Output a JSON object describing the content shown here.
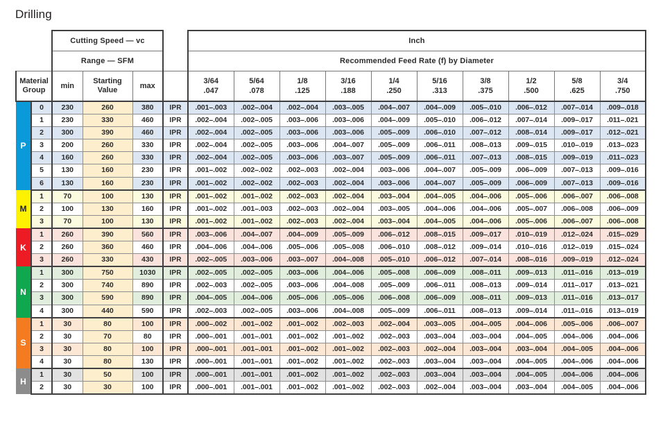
{
  "page": {
    "title": "Drilling"
  },
  "header": {
    "cutting_speed": "Cutting Speed — vc",
    "range_sfm": "Range — SFM",
    "unit_system": "Inch",
    "feed_rate": "Recommended Feed Rate (f) by Diameter",
    "material_group_l1": "Material",
    "material_group_l2": "Group",
    "min": "min",
    "starting_value_l1": "Starting",
    "starting_value_l2": "Value",
    "max": "max",
    "diameters": [
      {
        "fraction": "3/64",
        "decimal": ".047"
      },
      {
        "fraction": "5/64",
        "decimal": ".078"
      },
      {
        "fraction": "1/8",
        "decimal": ".125"
      },
      {
        "fraction": "3/16",
        "decimal": ".188"
      },
      {
        "fraction": "1/4",
        "decimal": ".250"
      },
      {
        "fraction": "5/16",
        "decimal": ".313"
      },
      {
        "fraction": "3/8",
        "decimal": ".375"
      },
      {
        "fraction": "1/2",
        "decimal": ".500"
      },
      {
        "fraction": "5/8",
        "decimal": ".625"
      },
      {
        "fraction": "3/4",
        "decimal": ".750"
      }
    ]
  },
  "colors": {
    "group_P": "#0b9ad9",
    "group_M": "#fff200",
    "group_K": "#ed1c24",
    "group_N": "#0fa84e",
    "group_S": "#f47b20",
    "group_H": "#8c8c8c",
    "tint_P": "#dce6f2",
    "tint_M": "#fbfbe0",
    "tint_K": "#fae3dc",
    "tint_N": "#e2eedd",
    "tint_S": "#fce7d4",
    "tint_H": "#e2e2e2",
    "starting_value_fill": "#fdeecd",
    "row_alt_fill": "#ffffff",
    "grid_line": "#8d8e90",
    "border_heavy": "#3f3f41"
  },
  "groups": [
    {
      "code": "P",
      "color": "#0b9ad9",
      "tint": "#dce6f2",
      "label_color": "#ffffff",
      "rows": [
        {
          "group_no": "0",
          "min": "230",
          "start": "260",
          "max": "380",
          "unit": "IPR",
          "feeds": [
            ".001–.003",
            ".002–.004",
            ".002–.004",
            ".003–.005",
            ".004–.007",
            ".004–.009",
            ".005–.010",
            ".006–.012",
            ".007–.014",
            ".009–.018"
          ]
        },
        {
          "group_no": "1",
          "min": "230",
          "start": "330",
          "max": "460",
          "unit": "IPR",
          "feeds": [
            ".002–.004",
            ".002–.005",
            ".003–.006",
            ".003–.006",
            ".004–.009",
            ".005–.010",
            ".006–.012",
            ".007–.014",
            ".009–.017",
            ".011–.021"
          ]
        },
        {
          "group_no": "2",
          "min": "300",
          "start": "390",
          "max": "460",
          "unit": "IPR",
          "feeds": [
            ".002–.004",
            ".002–.005",
            ".003–.006",
            ".003–.006",
            ".005–.009",
            ".006–.010",
            ".007–.012",
            ".008–.014",
            ".009–.017",
            ".012–.021"
          ]
        },
        {
          "group_no": "3",
          "min": "200",
          "start": "260",
          "max": "330",
          "unit": "IPR",
          "feeds": [
            ".002–.004",
            ".002–.005",
            ".003–.006",
            ".004–.007",
            ".005–.009",
            ".006–.011",
            ".008–.013",
            ".009–.015",
            ".010–.019",
            ".013–.023"
          ]
        },
        {
          "group_no": "4",
          "min": "160",
          "start": "260",
          "max": "330",
          "unit": "IPR",
          "feeds": [
            ".002–.004",
            ".002–.005",
            ".003–.006",
            ".003–.007",
            ".005–.009",
            ".006–.011",
            ".007–.013",
            ".008–.015",
            ".009–.019",
            ".011–.023"
          ]
        },
        {
          "group_no": "5",
          "min": "130",
          "start": "160",
          "max": "230",
          "unit": "IPR",
          "feeds": [
            ".001–.002",
            ".002–.002",
            ".002–.003",
            ".002–.004",
            ".003–.006",
            ".004–.007",
            ".005–.009",
            ".006–.009",
            ".007–.013",
            ".009–.016"
          ]
        },
        {
          "group_no": "6",
          "min": "130",
          "start": "160",
          "max": "230",
          "unit": "IPR",
          "feeds": [
            ".001–.002",
            ".002–.002",
            ".002–.003",
            ".002–.004",
            ".003–.006",
            ".004–.007",
            ".005–.009",
            ".006–.009",
            ".007–.013",
            ".009–.016"
          ]
        }
      ]
    },
    {
      "code": "M",
      "color": "#fff200",
      "tint": "#fbfbe0",
      "label_color": "#231f20",
      "rows": [
        {
          "group_no": "1",
          "min": "70",
          "start": "100",
          "max": "130",
          "unit": "IPR",
          "feeds": [
            ".001–.002",
            ".001–.002",
            ".002–.003",
            ".002–.004",
            ".003–.004",
            ".004–.005",
            ".004–.006",
            ".005–.006",
            ".006–.007",
            ".006–.008"
          ]
        },
        {
          "group_no": "2",
          "min": "100",
          "start": "130",
          "max": "160",
          "unit": "IPR",
          "feeds": [
            ".001–.002",
            ".001–.003",
            ".002–.003",
            ".002–.004",
            ".003–.005",
            ".004–.006",
            ".004–.006",
            ".005–.007",
            ".006–.008",
            ".006–.009"
          ]
        },
        {
          "group_no": "3",
          "min": "70",
          "start": "100",
          "max": "130",
          "unit": "IPR",
          "feeds": [
            ".001–.002",
            ".001–.002",
            ".002–.003",
            ".002–.004",
            ".003–.004",
            ".004–.005",
            ".004–.006",
            ".005–.006",
            ".006–.007",
            ".006–.008"
          ]
        }
      ]
    },
    {
      "code": "K",
      "color": "#ed1c24",
      "tint": "#fae3dc",
      "label_color": "#ffffff",
      "rows": [
        {
          "group_no": "1",
          "min": "260",
          "start": "390",
          "max": "560",
          "unit": "IPR",
          "feeds": [
            ".003–.006",
            ".004–.007",
            ".004–.009",
            ".005–.009",
            ".006–.012",
            ".008–.015",
            ".009–.017",
            ".010–.019",
            ".012–.024",
            ".015–.029"
          ]
        },
        {
          "group_no": "2",
          "min": "260",
          "start": "360",
          "max": "460",
          "unit": "IPR",
          "feeds": [
            ".004–.006",
            ".004–.006",
            ".005–.006",
            ".005–.008",
            ".006–.010",
            ".008–.012",
            ".009–.014",
            ".010–.016",
            ".012–.019",
            ".015–.024"
          ]
        },
        {
          "group_no": "3",
          "min": "260",
          "start": "330",
          "max": "430",
          "unit": "IPR",
          "feeds": [
            ".002–.005",
            ".003–.006",
            ".003–.007",
            ".004–.008",
            ".005–.010",
            ".006–.012",
            ".007–.014",
            ".008–.016",
            ".009–.019",
            ".012–.024"
          ]
        }
      ]
    },
    {
      "code": "N",
      "color": "#0fa84e",
      "tint": "#e2eedd",
      "label_color": "#ffffff",
      "rows": [
        {
          "group_no": "1",
          "min": "300",
          "start": "750",
          "max": "1030",
          "unit": "IPR",
          "feeds": [
            ".002–.005",
            ".002–.005",
            ".003–.006",
            ".004–.006",
            ".005–.008",
            ".006–.009",
            ".008–.011",
            ".009–.013",
            ".011–.016",
            ".013–.019"
          ]
        },
        {
          "group_no": "2",
          "min": "300",
          "start": "740",
          "max": "890",
          "unit": "IPR",
          "feeds": [
            ".002–.003",
            ".002–.005",
            ".003–.006",
            ".004–.008",
            ".005–.009",
            ".006–.011",
            ".008–.013",
            ".009–.014",
            ".011–.017",
            ".013–.021"
          ]
        },
        {
          "group_no": "3",
          "min": "300",
          "start": "590",
          "max": "890",
          "unit": "IPR",
          "feeds": [
            ".004–.005",
            ".004–.006",
            ".005–.006",
            ".005–.006",
            ".006–.008",
            ".006–.009",
            ".008–.011",
            ".009–.013",
            ".011–.016",
            ".013–.017"
          ]
        },
        {
          "group_no": "4",
          "min": "300",
          "start": "440",
          "max": "590",
          "unit": "IPR",
          "feeds": [
            ".002–.003",
            ".002–.005",
            ".003–.006",
            ".004–.008",
            ".005–.009",
            ".006–.011",
            ".008–.013",
            ".009–.014",
            ".011–.016",
            ".013–.019"
          ]
        }
      ]
    },
    {
      "code": "S",
      "color": "#f47b20",
      "tint": "#fce7d4",
      "label_color": "#ffffff",
      "rows": [
        {
          "group_no": "1",
          "min": "30",
          "start": "80",
          "max": "100",
          "unit": "IPR",
          "feeds": [
            ".000–.002",
            ".001–.002",
            ".001–.002",
            ".002–.003",
            ".002–.004",
            ".003–.005",
            ".004–.005",
            ".004–.006",
            ".005–.006",
            ".006–.007"
          ]
        },
        {
          "group_no": "2",
          "min": "30",
          "start": "70",
          "max": "80",
          "unit": "IPR",
          "feeds": [
            ".000–.001",
            ".001–.001",
            ".001–.002",
            ".001–.002",
            ".002–.003",
            ".003–.004",
            ".003–.004",
            ".004–.005",
            ".004–.006",
            ".004–.006"
          ]
        },
        {
          "group_no": "3",
          "min": "30",
          "start": "80",
          "max": "100",
          "unit": "IPR",
          "feeds": [
            ".000–.001",
            ".001–.001",
            ".001–.002",
            ".001–.002",
            ".002–.003",
            ".002–.004",
            ".003–.004",
            ".003–.004",
            ".004–.005",
            ".004–.006"
          ]
        },
        {
          "group_no": "4",
          "min": "30",
          "start": "80",
          "max": "130",
          "unit": "IPR",
          "feeds": [
            ".000–.001",
            ".001–.001",
            ".001–.002",
            ".001–.002",
            ".002–.003",
            ".003–.004",
            ".003–.004",
            ".004–.005",
            ".004–.006",
            ".004–.006"
          ]
        }
      ]
    },
    {
      "code": "H",
      "color": "#8c8c8c",
      "tint": "#e2e2e2",
      "label_color": "#ffffff",
      "rows": [
        {
          "group_no": "1",
          "min": "30",
          "start": "50",
          "max": "100",
          "unit": "IPR",
          "feeds": [
            ".000–.001",
            ".001–.001",
            ".001–.002",
            ".001–.002",
            ".002–.003",
            ".003–.004",
            ".003–.004",
            ".004–.005",
            ".004–.006",
            ".004–.006"
          ]
        },
        {
          "group_no": "2",
          "min": "30",
          "start": "30",
          "max": "100",
          "unit": "IPR",
          "feeds": [
            ".000–.001",
            ".001–.001",
            ".001–.002",
            ".001–.002",
            ".002–.003",
            ".002–.004",
            ".003–.004",
            ".003–.004",
            ".004–.005",
            ".004–.006"
          ]
        }
      ]
    }
  ]
}
